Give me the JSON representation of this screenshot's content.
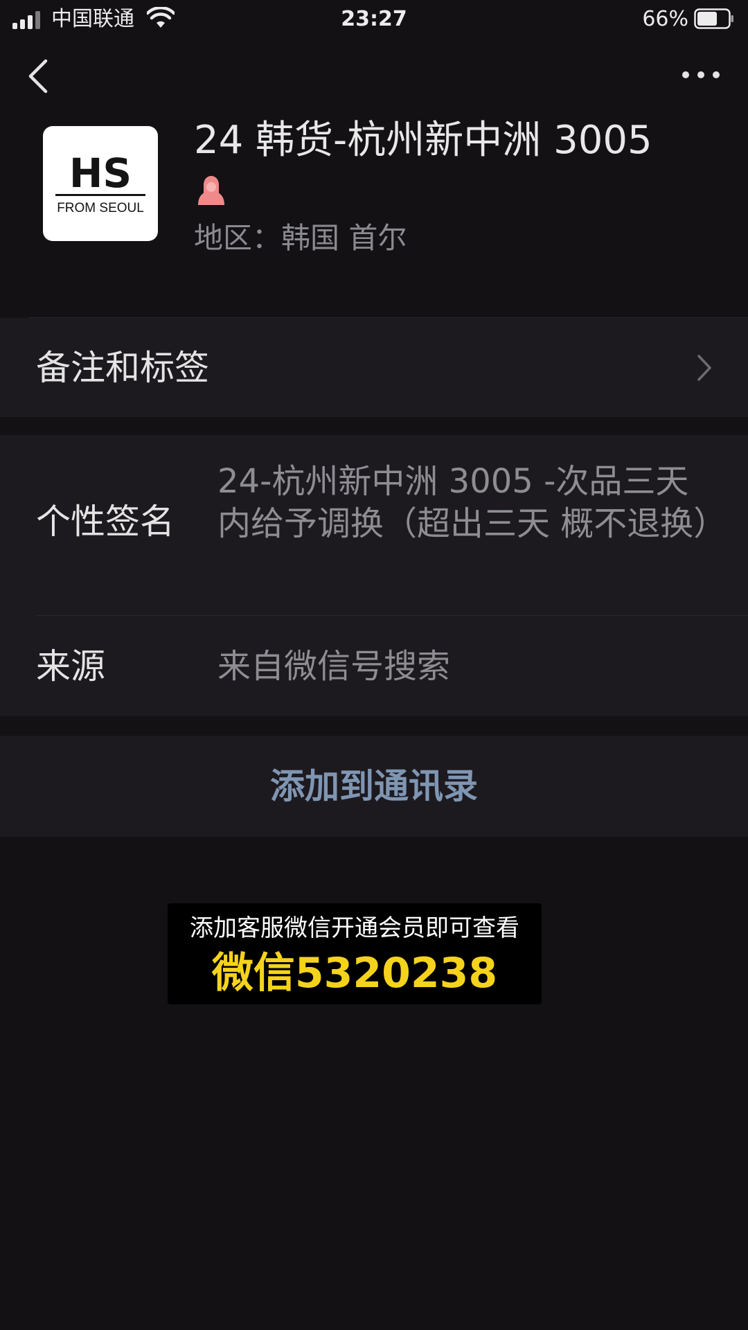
{
  "status_bar": {
    "carrier": "中国联通",
    "time": "23:27",
    "battery_percent": "66%",
    "battery_level": 0.66,
    "icons": [
      "signal-icon",
      "wifi-icon",
      "battery-icon"
    ]
  },
  "nav": {
    "back_icon": "chevron-left-icon",
    "more_icon": "more-dots-icon"
  },
  "profile": {
    "name": "24 韩货-杭州新中洲 3005",
    "gender_icon": "female-icon",
    "region": "地区：韩国 首尔",
    "avatar": {
      "logo_text": "HS",
      "logo_subtext": "FROM SEOUL"
    }
  },
  "cells": {
    "remark_label": "备注和标签",
    "signature_label": "个性签名",
    "signature_value": "24-杭州新中洲 3005 -次品三天内给予调换（超出三天 概不退换）",
    "source_label": "来源",
    "source_value": "来自微信号搜索"
  },
  "actions": {
    "add_contact": "添加到通讯录"
  },
  "promo": {
    "line1": "添加客服微信开通会员即可查看",
    "line2": "微信5320238"
  },
  "colors": {
    "background": "#141115",
    "cell_background": "#1d1a1f",
    "link_blue": "#7f96b3",
    "promo_yellow": "#f5d31c",
    "female_pink": "#f08a8a"
  }
}
